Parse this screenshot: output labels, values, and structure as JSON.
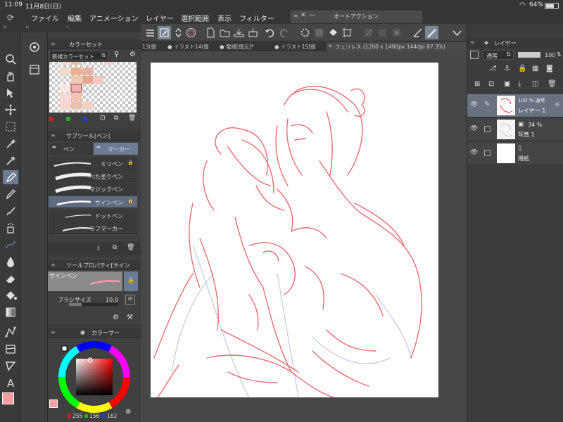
{
  "status": {
    "time": "11:09",
    "date": "11月8日(日)",
    "battery": "64%"
  },
  "menu": [
    "ファイル",
    "編集",
    "アニメーション",
    "レイヤー",
    "選択範囲",
    "表示",
    "フィルター"
  ],
  "autoaction": {
    "title": "オートアクション"
  },
  "colorset": {
    "title": "カラーセット",
    "select": "新規カラーセット"
  },
  "subtool": {
    "title": "サブツール[ペン]",
    "tabs": [
      "ペン",
      "マーカー"
    ],
    "brushes": [
      "ミリペン",
      "べた塗りペン",
      "マジックペン",
      "サインペン",
      "ドットペン",
      "ラフマーカー"
    ]
  },
  "toolprop": {
    "title": "ツールプロパティ[サイン",
    "preview_label": "サインペン",
    "brush_size_label": "ブラシサイズ",
    "brush_size": "10.0"
  },
  "colorcircle": {
    "title": "カラーサー",
    "r": "255",
    "g": "156",
    "b": "162",
    "main_color": "#ff9ca2"
  },
  "tabs": [
    "13(復",
    "● イラスト14(復",
    "● 竜崎[復元]*",
    "● イラスト15[復",
    "フェリレス (1200 x 1400px 144dpi 87.3%)"
  ],
  "layers": {
    "title": "レイヤー",
    "blend": "通常",
    "opacity": "100",
    "items": [
      {
        "name": "レイヤー 1",
        "info": "100 % 通常"
      },
      {
        "name": "写真 1",
        "info": "34 %"
      },
      {
        "name": "用紙",
        "info": ""
      }
    ]
  },
  "colors": {
    "accent": "#7a8596",
    "sketch_red": "#e8393f",
    "sketch_blue": "#9fb4d6"
  }
}
